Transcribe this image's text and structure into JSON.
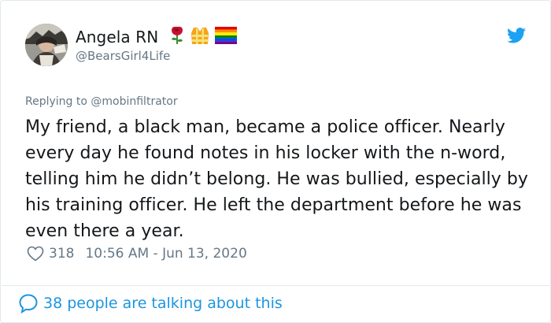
{
  "user": {
    "name": "Angela RN",
    "handle": "@BearsGirl4Life",
    "badges": [
      "rose-icon",
      "safety-vest-icon",
      "rainbow-flag-icon"
    ]
  },
  "reply": {
    "prefix": "Replying to",
    "mention": "@mobinfiltrator"
  },
  "tweet": {
    "text": "My friend, a black man, became a police officer. Nearly every day he found notes in his locker with the n-word, telling him he didn’t belong. He was bullied, especially by his training officer. He left the department before he was even there a year."
  },
  "meta": {
    "likes": "318",
    "timestamp": "10:56 AM - Jun 13, 2020"
  },
  "footer": {
    "talking": "38 people are talking about this"
  },
  "colors": {
    "brand": "#1da1f2",
    "link": "#1b95e0",
    "muted": "#657786",
    "text": "#14171a",
    "border": "#e1e8ed"
  }
}
